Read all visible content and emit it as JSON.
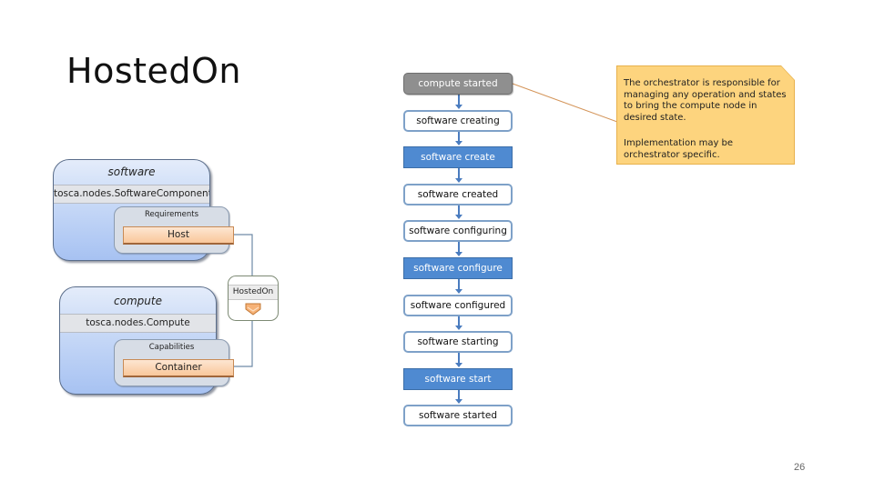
{
  "slide": {
    "title": "HostedOn",
    "page_number": "26"
  },
  "nodes": {
    "software": {
      "name": "software",
      "type": "tosca.nodes.SoftwareComponent",
      "section_label": "Requirements",
      "port_label": "Host"
    },
    "compute": {
      "name": "compute",
      "type": "tosca.nodes.Compute",
      "section_label": "Capabilities",
      "port_label": "Container"
    }
  },
  "relationship": {
    "label": "HostedOn",
    "icon": "relationship-chevron-icon"
  },
  "flow": {
    "steps": [
      {
        "label": "compute started",
        "state": "done"
      },
      {
        "label": "software creating",
        "state": "plain"
      },
      {
        "label": "software create",
        "state": "active"
      },
      {
        "label": "software created",
        "state": "plain"
      },
      {
        "label": "software configuring",
        "state": "plain"
      },
      {
        "label": "software configure",
        "state": "active"
      },
      {
        "label": "software configured",
        "state": "plain"
      },
      {
        "label": "software starting",
        "state": "plain"
      },
      {
        "label": "software start",
        "state": "active"
      },
      {
        "label": "software started",
        "state": "plain"
      }
    ]
  },
  "note": {
    "paragraph1": "The orchestrator is responsible for managing any operation and states to bring the compute node in desired state.",
    "paragraph2": "Implementation may be orchestrator specific."
  },
  "colors": {
    "active_step": "#4f8ad1",
    "done_step": "#8f8f8f",
    "step_border": "#7ea1c8",
    "arrow": "#4a7cbf",
    "note_fill": "#fdd47e",
    "connector": "#6f8aa6",
    "note_connector": "#d4955a"
  }
}
